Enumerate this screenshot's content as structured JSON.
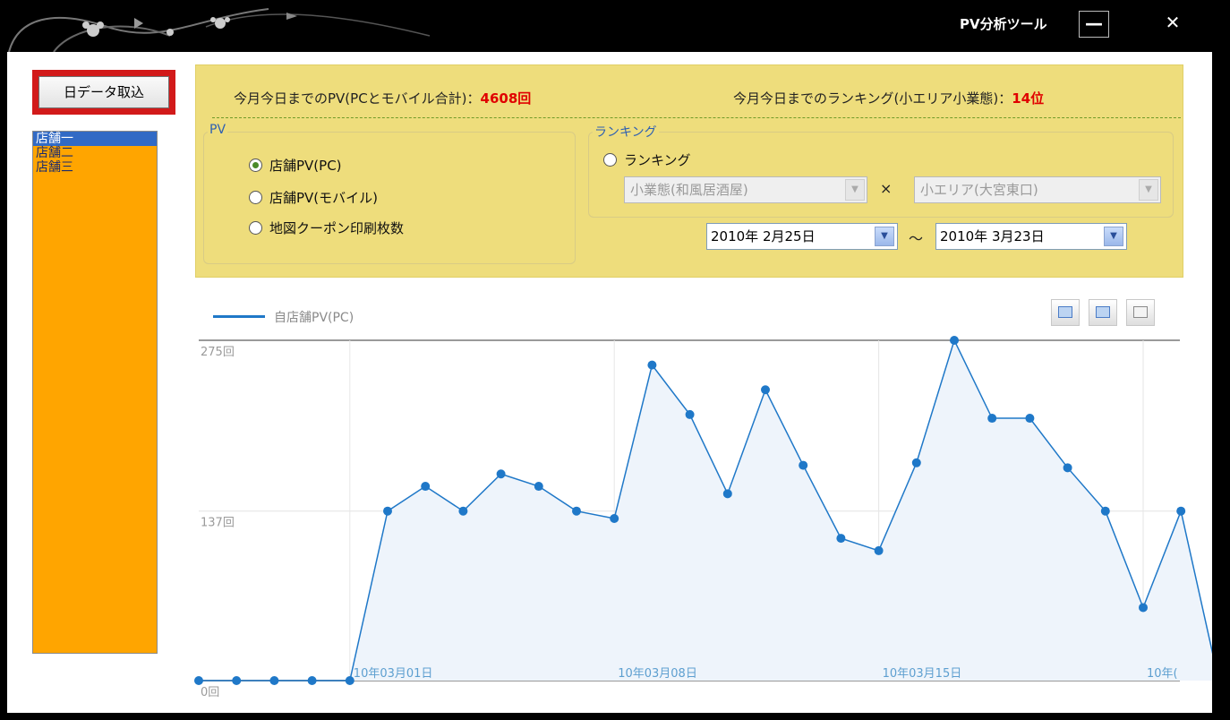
{
  "window": {
    "title": "PV分析ツール",
    "minimize_glyph": "—",
    "close_glyph": "✕"
  },
  "toolbar": {
    "fetch_button_label": "日データ取込"
  },
  "stores": {
    "items": [
      "店舗一",
      "店舗二",
      "店舗三"
    ],
    "selected_index": 0
  },
  "summary": {
    "pv_label": "今月今日までのPV(PCとモバイル合計)：",
    "pv_value": "4608回",
    "rank_label": "今月今日までのランキング(小エリア小業態)：",
    "rank_value": "14位"
  },
  "pv_group": {
    "legend": "PV",
    "options": [
      {
        "label": "店舗PV(PC)",
        "checked": true
      },
      {
        "label": "店舗PV(モバイル)",
        "checked": false
      },
      {
        "label": "地図クーポン印刷枚数",
        "checked": false
      }
    ]
  },
  "ranking_group": {
    "legend": "ランキング",
    "option_label": "ランキング",
    "business_type": "小業態(和風居酒屋)",
    "times_symbol": "×",
    "area": "小エリア(大宮東口)"
  },
  "date_range": {
    "from": "2010年 2月25日",
    "separator": "～",
    "to": "2010年 3月23日"
  },
  "chart_legend": "自店舗PV(PC)",
  "colors": {
    "accent_line": "#1f78c8",
    "store_list_bg": "#ffa500",
    "panel_bg": "#eedd7c",
    "highlight_red": "#e00000"
  },
  "chart_data": {
    "type": "area",
    "ylim": [
      0,
      275
    ],
    "y_ticks": [
      {
        "value": 275,
        "label": "275回"
      },
      {
        "value": 137,
        "label": "137回"
      },
      {
        "value": 0,
        "label": "0回"
      }
    ],
    "x_ticks": [
      {
        "index": 4,
        "label": "10年03月01日"
      },
      {
        "index": 11,
        "label": "10年03月08日"
      },
      {
        "index": 18,
        "label": "10年03月15日"
      },
      {
        "index": 25,
        "label": "10年("
      }
    ],
    "grid": true,
    "legend_position": "top-left",
    "series": [
      {
        "name": "自店舗PV(PC)",
        "values": [
          0,
          0,
          0,
          0,
          0,
          137,
          157,
          137,
          167,
          157,
          137,
          131,
          255,
          215,
          151,
          235,
          174,
          115,
          105,
          176,
          275,
          212,
          212,
          172,
          137,
          59,
          137,
          0
        ]
      }
    ]
  }
}
